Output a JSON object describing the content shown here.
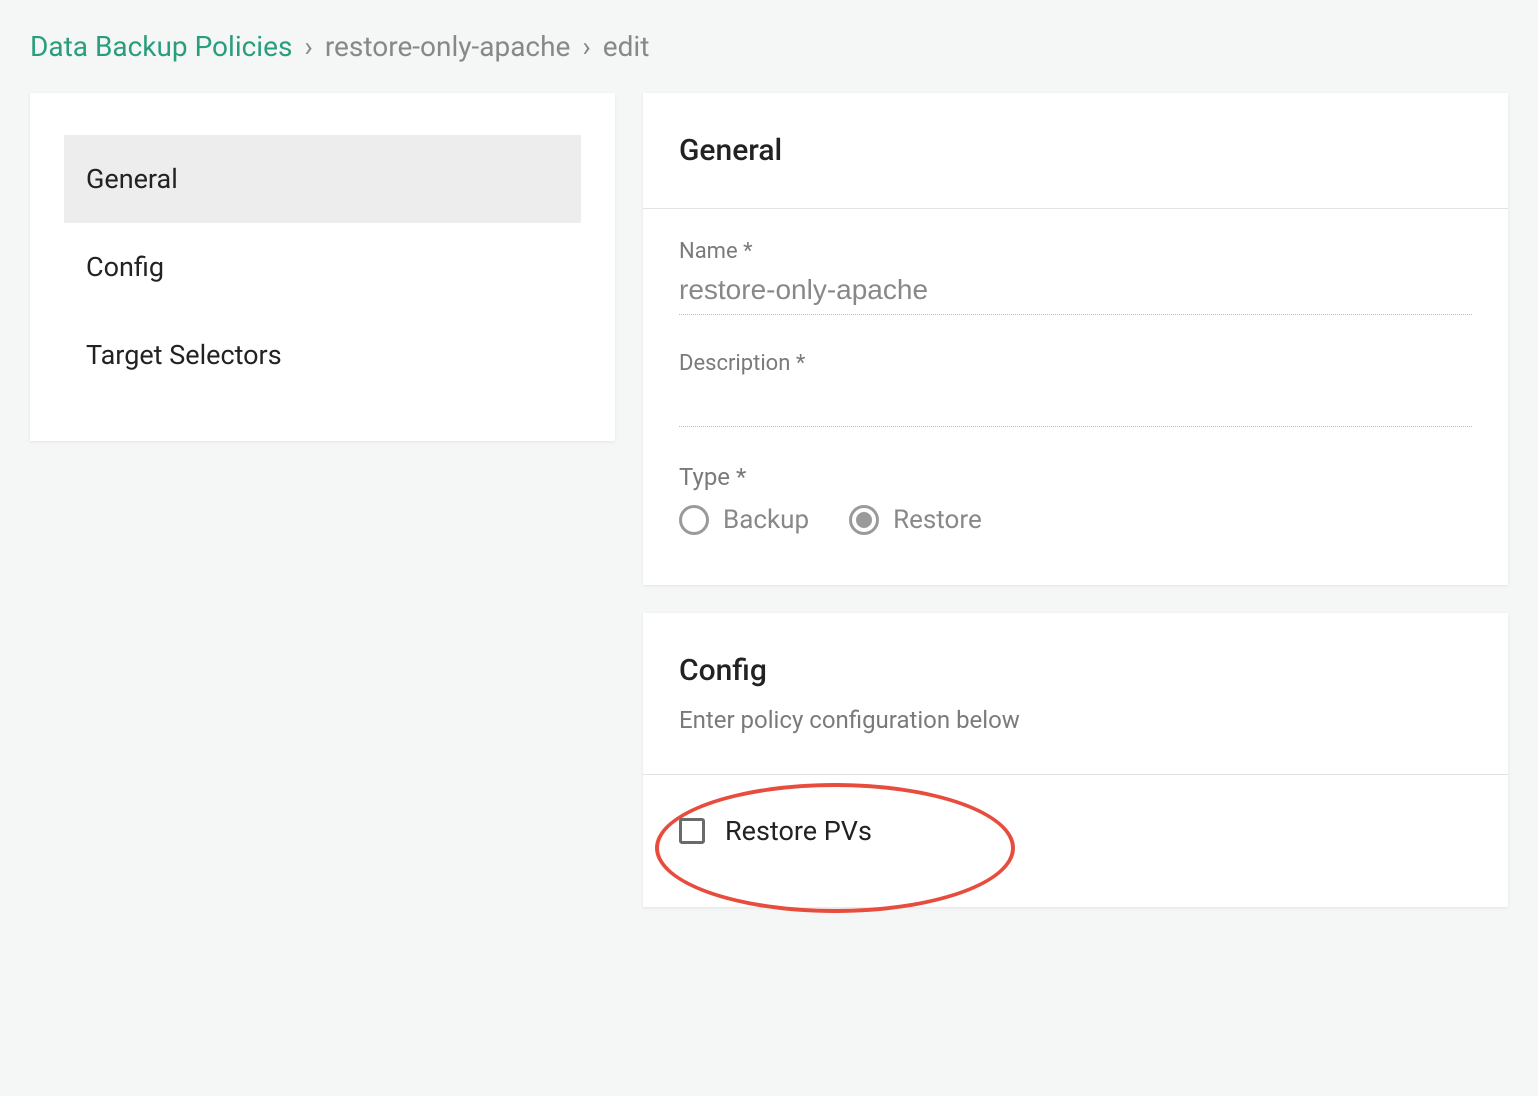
{
  "breadcrumb": {
    "root": "Data Backup Policies",
    "item": "restore-only-apache",
    "action": "edit",
    "separator": "›"
  },
  "sidebar": {
    "items": [
      {
        "label": "General",
        "active": true
      },
      {
        "label": "Config",
        "active": false
      },
      {
        "label": "Target Selectors",
        "active": false
      }
    ]
  },
  "general": {
    "heading": "General",
    "name": {
      "label": "Name *",
      "value": "restore-only-apache"
    },
    "description": {
      "label": "Description *",
      "value": ""
    },
    "type": {
      "label": "Type *",
      "options": [
        {
          "label": "Backup",
          "selected": false
        },
        {
          "label": "Restore",
          "selected": true
        }
      ]
    }
  },
  "config": {
    "heading": "Config",
    "subheading": "Enter policy configuration below",
    "restore_pvs": {
      "label": "Restore PVs",
      "checked": false
    }
  }
}
